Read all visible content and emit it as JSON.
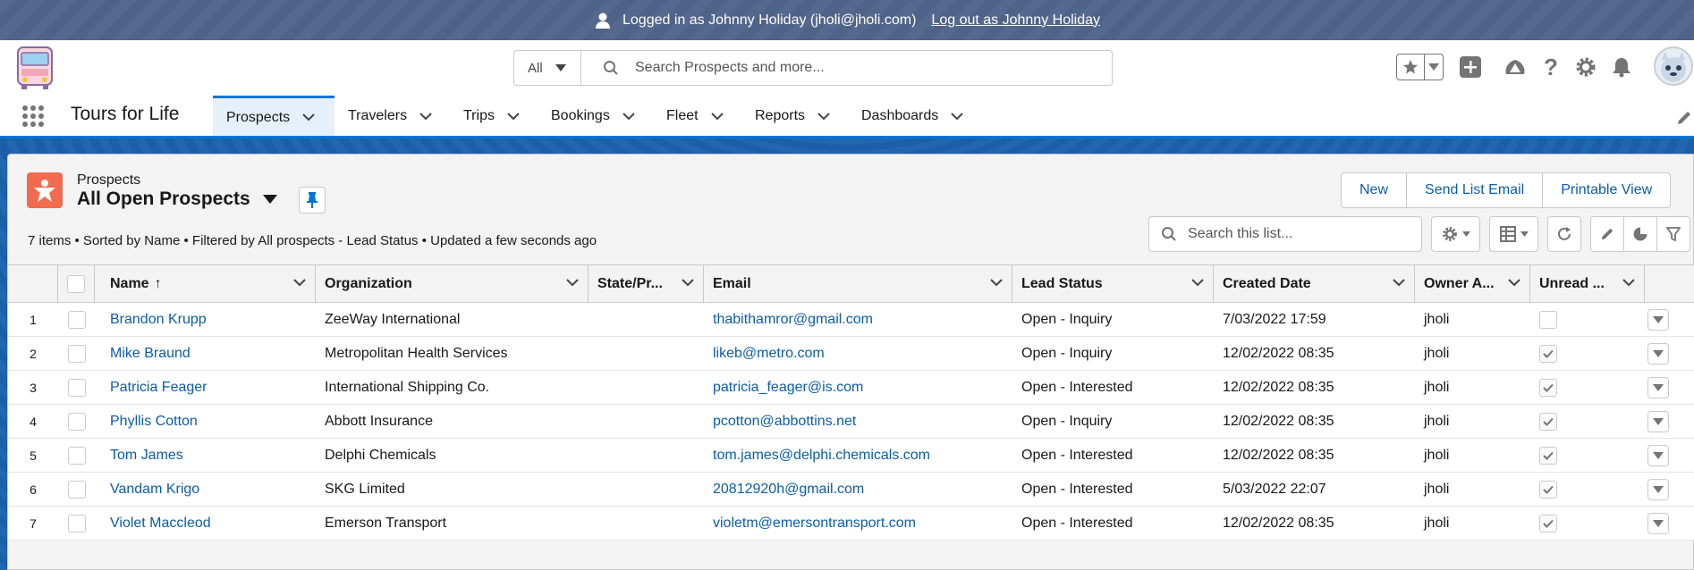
{
  "banner": {
    "logged_in_text": "Logged in as Johnny Holiday (jholi@jholi.com)",
    "logout_text": "Log out as Johnny Holiday"
  },
  "header": {
    "search_scope": "All",
    "search_placeholder": "Search Prospects and more..."
  },
  "nav": {
    "app_name": "Tours for Life",
    "tabs": [
      {
        "label": "Prospects",
        "active": true
      },
      {
        "label": "Travelers"
      },
      {
        "label": "Trips"
      },
      {
        "label": "Bookings"
      },
      {
        "label": "Fleet"
      },
      {
        "label": "Reports"
      },
      {
        "label": "Dashboards"
      }
    ]
  },
  "list": {
    "object_label": "Prospects",
    "title": "All Open Prospects",
    "meta": "7 items • Sorted by Name • Filtered by All prospects - Lead Status • Updated a few seconds ago",
    "buttons": {
      "new": "New",
      "send_email": "Send List Email",
      "printable": "Printable View"
    },
    "search_placeholder": "Search this list..."
  },
  "table": {
    "columns": [
      "Name",
      "Organization",
      "State/Pr...",
      "Email",
      "Lead Status",
      "Created Date",
      "Owner A...",
      "Unread ..."
    ],
    "sort_indicator": "↑",
    "rows": [
      {
        "num": "1",
        "name": "Brandon Krupp",
        "org": "ZeeWay International",
        "state": "",
        "email": "thabithamror@gmail.com",
        "status": "Open - Inquiry",
        "created": "7/03/2022 17:59",
        "owner": "jholi",
        "unread": false
      },
      {
        "num": "2",
        "name": "Mike Braund",
        "org": "Metropolitan Health Services",
        "state": "",
        "email": "likeb@metro.com",
        "status": "Open - Inquiry",
        "created": "12/02/2022 08:35",
        "owner": "jholi",
        "unread": true
      },
      {
        "num": "3",
        "name": "Patricia Feager",
        "org": "International Shipping Co.",
        "state": "",
        "email": "patricia_feager@is.com",
        "status": "Open - Interested",
        "created": "12/02/2022 08:35",
        "owner": "jholi",
        "unread": true
      },
      {
        "num": "4",
        "name": "Phyllis Cotton",
        "org": "Abbott Insurance",
        "state": "",
        "email": "pcotton@abbottins.net",
        "status": "Open - Inquiry",
        "created": "12/02/2022 08:35",
        "owner": "jholi",
        "unread": true
      },
      {
        "num": "5",
        "name": "Tom James",
        "org": "Delphi Chemicals",
        "state": "",
        "email": "tom.james@delphi.chemicals.com",
        "status": "Open - Interested",
        "created": "12/02/2022 08:35",
        "owner": "jholi",
        "unread": true
      },
      {
        "num": "6",
        "name": "Vandam Krigo",
        "org": "SKG Limited",
        "state": "",
        "email": "20812920h@gmail.com",
        "status": "Open - Interested",
        "created": "5/03/2022 22:07",
        "owner": "jholi",
        "unread": true
      },
      {
        "num": "7",
        "name": "Violet Maccleod",
        "org": "Emerson Transport",
        "state": "",
        "email": "violetm@emersontransport.com",
        "status": "Open - Interested",
        "created": "12/02/2022 08:35",
        "owner": "jholi",
        "unread": true
      }
    ]
  },
  "colors": {
    "brand": "#0176d3",
    "link": "#0b5cab",
    "object_icon": "#f26b50",
    "banner": "#54698d"
  }
}
